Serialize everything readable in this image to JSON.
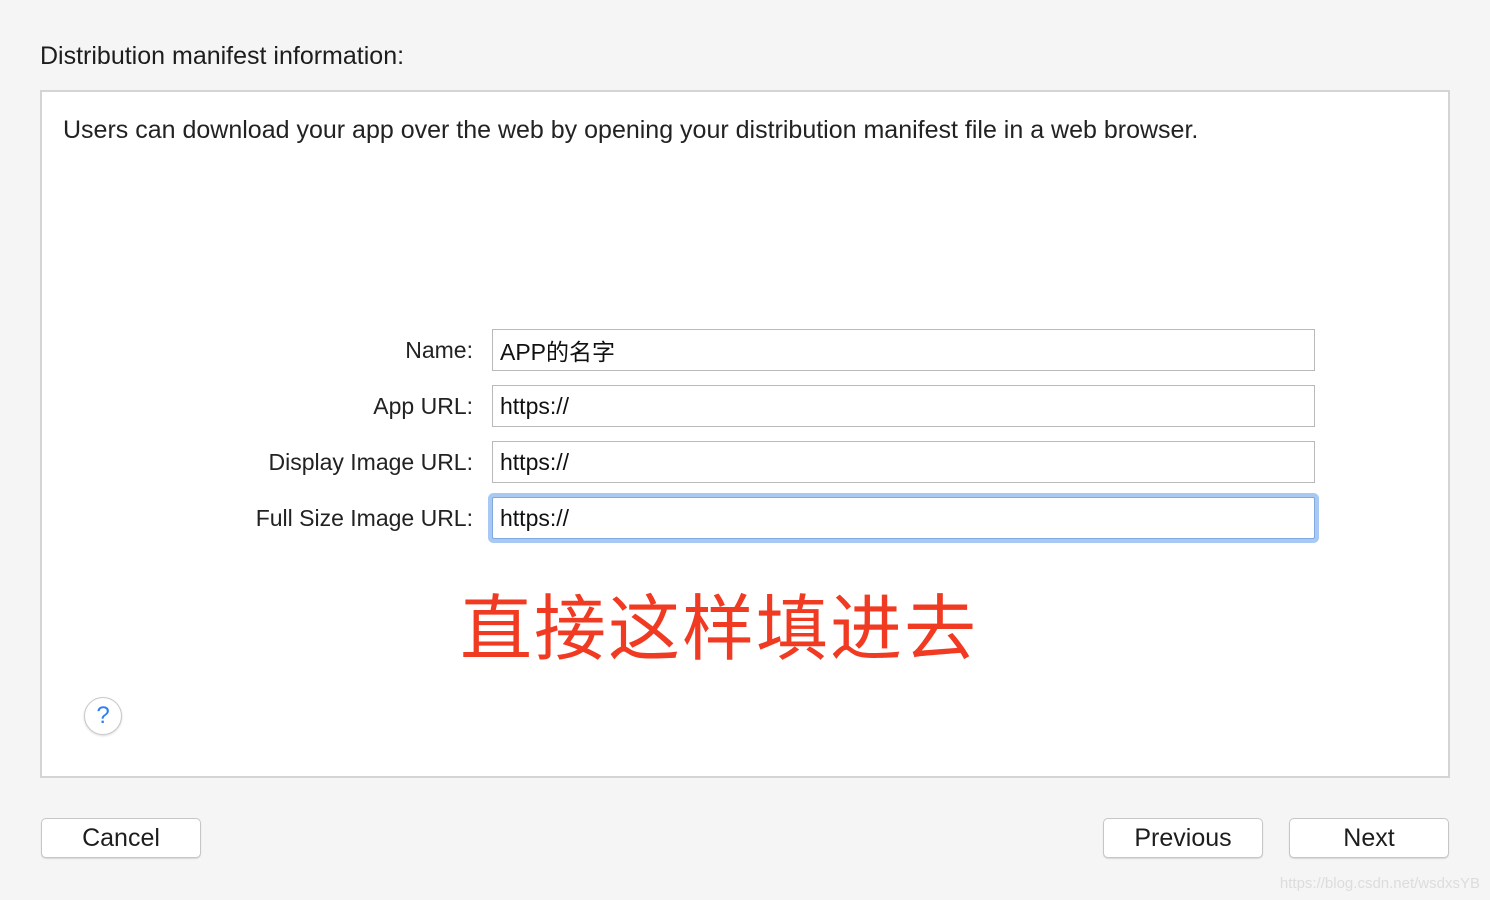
{
  "section_title": "Distribution manifest information:",
  "description": "Users can download your app over the web by opening your distribution manifest file in a web browser.",
  "fields": [
    {
      "label": "Name:",
      "value": "APP的名字"
    },
    {
      "label": "App URL:",
      "value": "https://"
    },
    {
      "label": "Display Image URL:",
      "value": "https://"
    },
    {
      "label": "Full Size Image URL:",
      "value": "https://"
    }
  ],
  "focused_field": "Full Size Image URL:",
  "annotation": "直接这样填进去",
  "help_icon": "question-mark",
  "help_symbol": "?",
  "buttons": {
    "cancel": "Cancel",
    "previous": "Previous",
    "next": "Next"
  },
  "watermark": "https://blog.csdn.net/wsdxsYB",
  "colors": {
    "annotation": "#f03a22",
    "focus_ring": "#a8c9f3",
    "help_icon": "#2d7ff0"
  }
}
